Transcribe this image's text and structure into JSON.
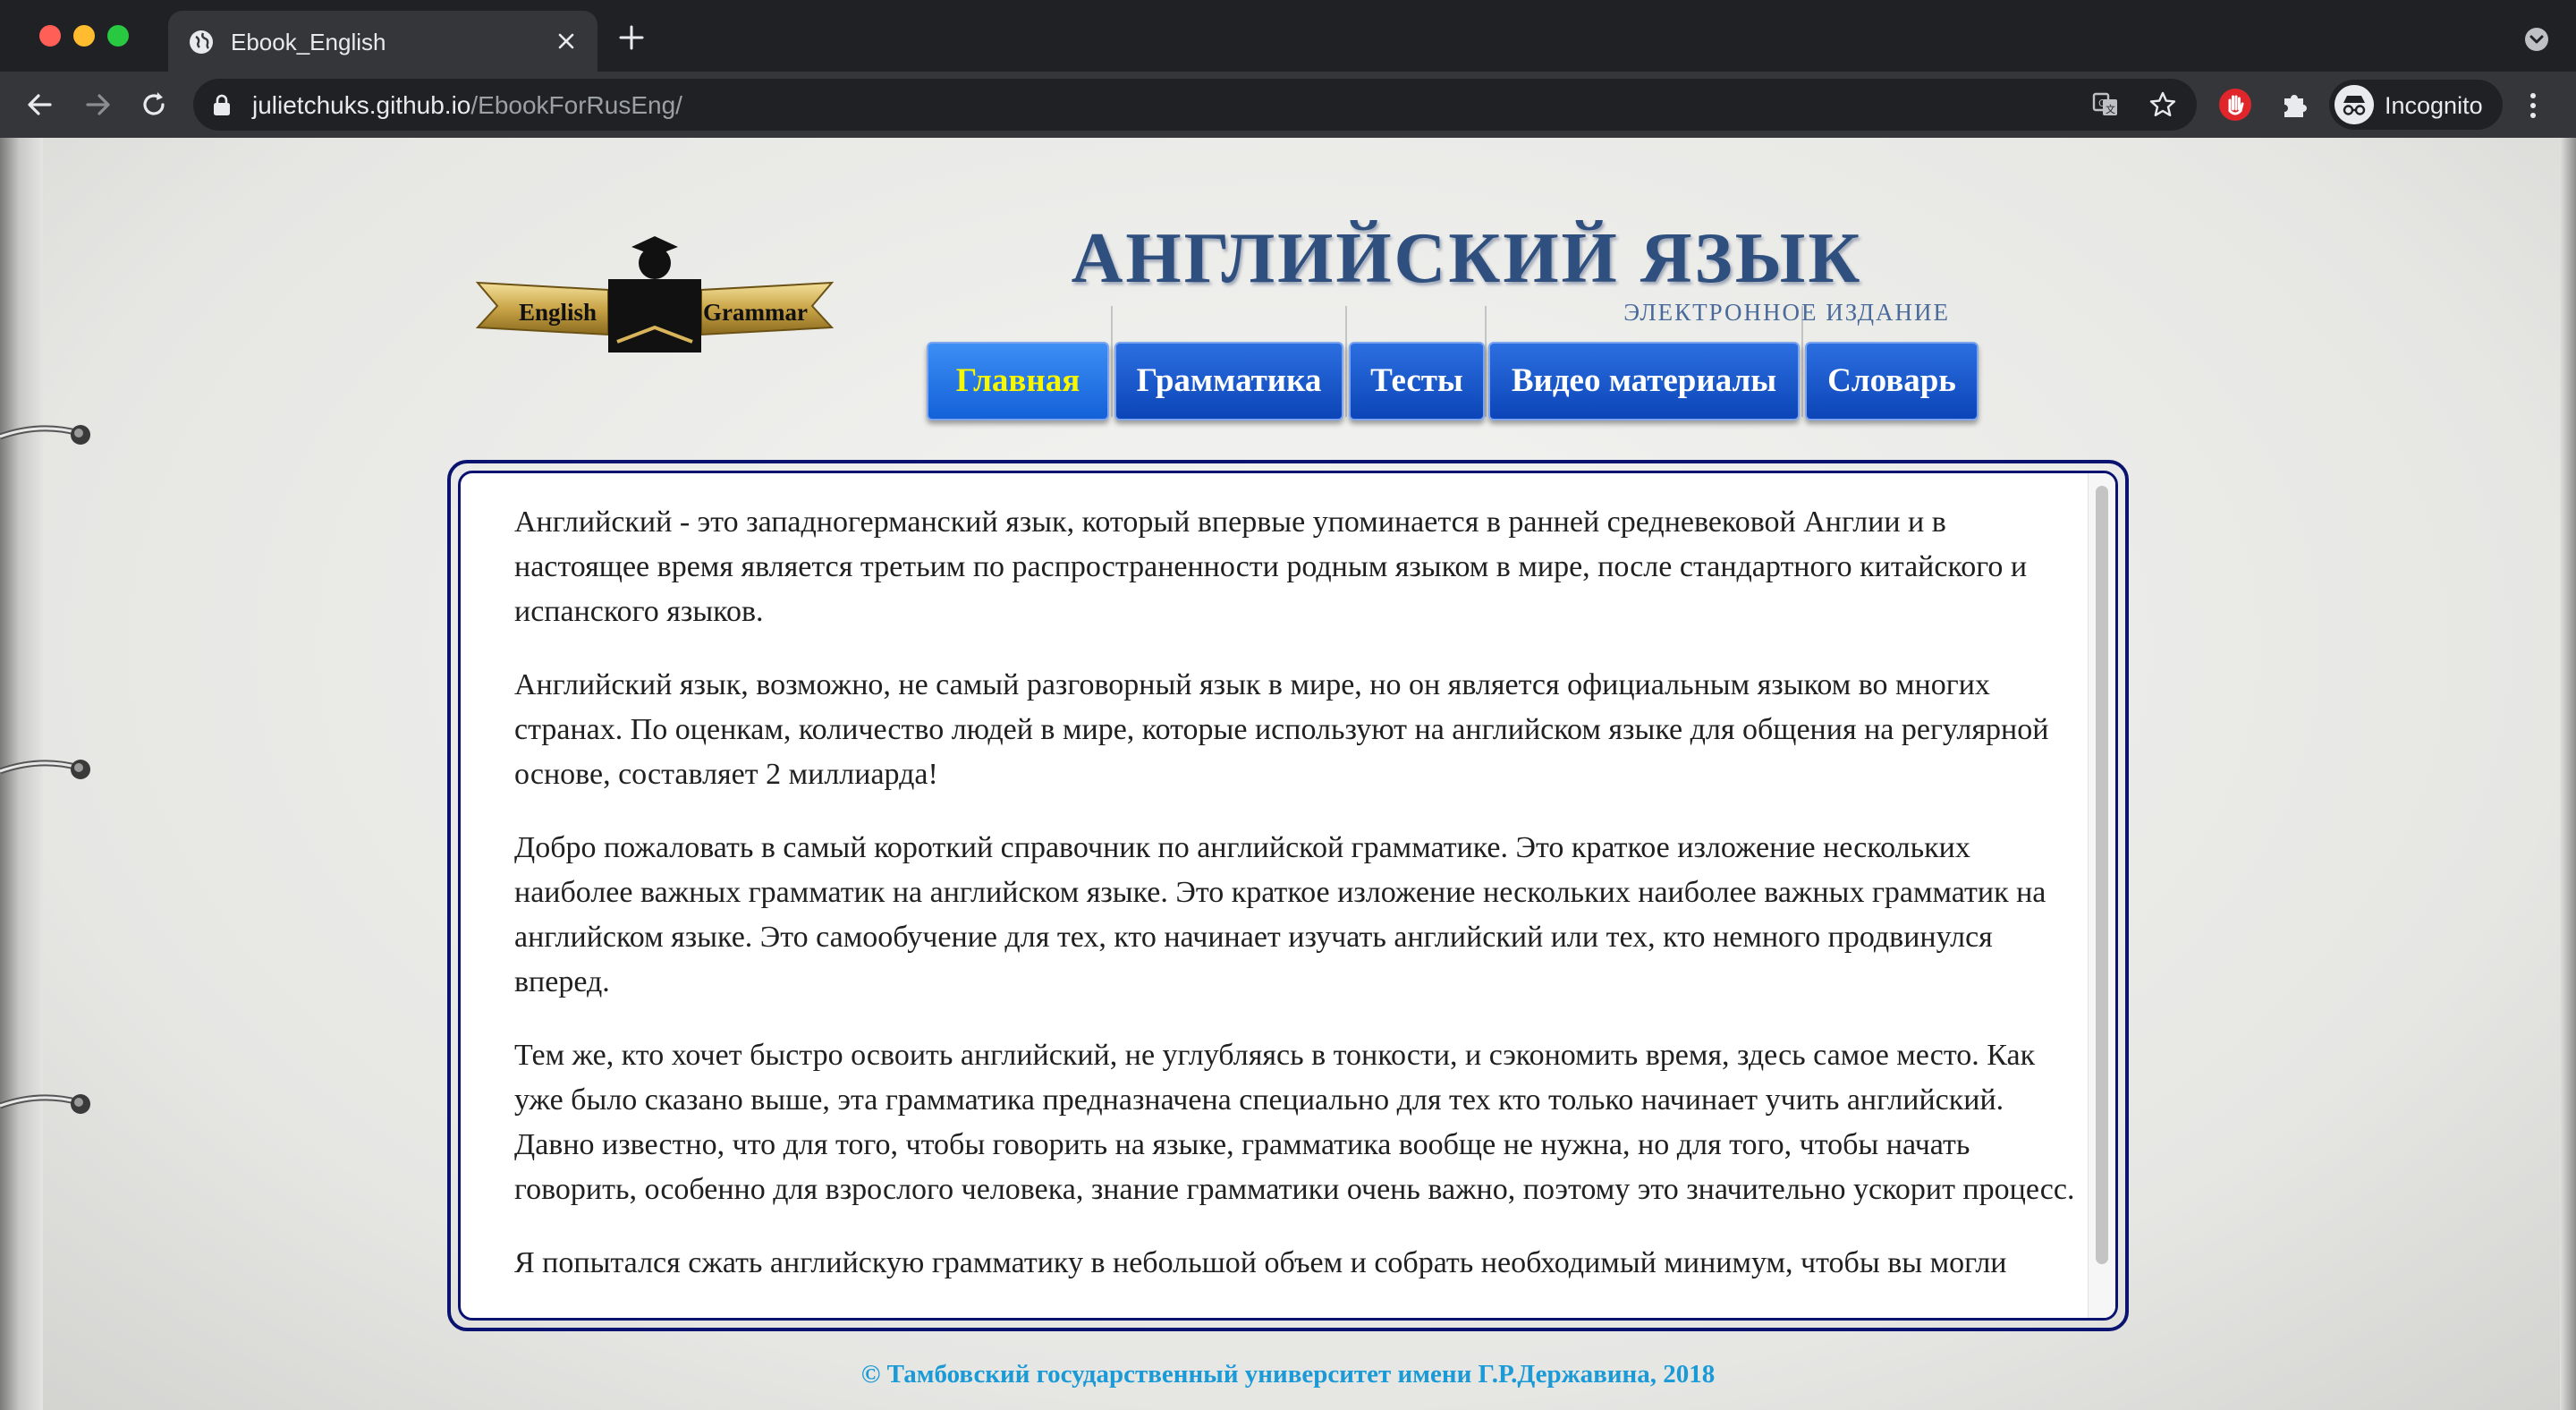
{
  "browser": {
    "tab_title": "Ebook_English",
    "url_host": "julietchuks.github.io",
    "url_path": "/EbookForRusEng/",
    "profile_label": "Incognito"
  },
  "header": {
    "logo": {
      "left_word": "English",
      "right_word": "Grammar"
    },
    "title": "АНГЛИЙСКИЙ ЯЗЫК",
    "subtitle": "ЭЛЕКТРОННОЕ ИЗДАНИЕ"
  },
  "nav": {
    "items": [
      {
        "label": "Главная",
        "active": true
      },
      {
        "label": "Грамматика",
        "active": false
      },
      {
        "label": "Тесты",
        "active": false
      },
      {
        "label": "Видео материалы",
        "active": false
      },
      {
        "label": "Словарь",
        "active": false
      }
    ]
  },
  "content": {
    "paragraphs": [
      "Английский - это западногерманский язык, который впервые упоминается в ранней средневековой Англии и в настоящее время является третьим по распространенности родным языком в мире, после стандартного китайского и испанского языков.",
      "Английский язык, возможно, не самый разговорный язык в мире, но он является официальным языком во многих странах. По оценкам, количество людей в мире, которые используют на английском языке для общения на регулярной основе, составляет 2 миллиарда!",
      "Добро пожаловать в самый короткий справочник по английской грамматике. Это краткое изложение нескольких наиболее важных грамматик на английском языке. Это краткое изложение нескольких наиболее важных грамматик на английском языке. Это самообучение для тех, кто начинает изучать английский или тех, кто немного продвинулся вперед.",
      "Тем же, кто хочет быстро освоить английский, не углубляясь в тонкости, и сэкономить время, здесь самое место. Как уже было сказано выше, эта грамматика предназначена специально для тех кто только начинает учить английский. Давно известно, что для того, чтобы говорить на языке, грамматика вообще не нужна, но для того, чтобы начать говорить, особенно для взрослого человека, знание грамматики очень важно, поэтому это значительно ускорит процесс.",
      "Я попытался сжать английскую грамматику в небольшой объем и собрать необходимый минимум, чтобы вы могли"
    ]
  },
  "footer": {
    "text": "© Тамбовский государственный университет имени Г.Р.Державина, 2018"
  },
  "colors": {
    "nav_button": "#0c45b8",
    "nav_active_text": "#f7f700",
    "frame_border": "#0b1370",
    "footer_text": "#1a9ad6",
    "title_text": "#2f4f7f"
  },
  "icons": {
    "tab": "globe-icon",
    "lock": "lock-icon",
    "translate": "translate-icon",
    "bookmark": "star-icon",
    "extension_block": "hand-stop-icon",
    "extensions": "puzzle-icon",
    "profile": "incognito-icon",
    "menu": "kebab-menu-icon"
  }
}
